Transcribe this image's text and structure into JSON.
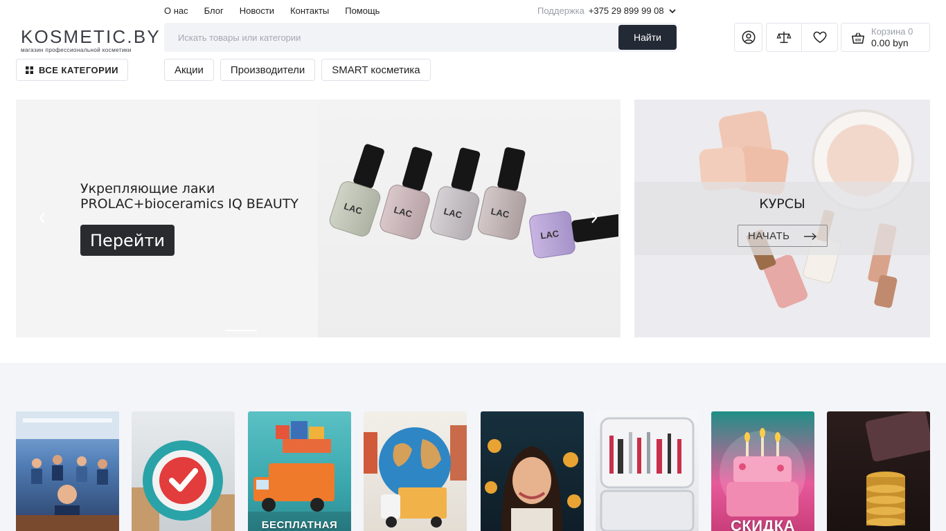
{
  "topnav": {
    "items": [
      "О нас",
      "Блог",
      "Новости",
      "Контакты",
      "Помощь"
    ]
  },
  "support": {
    "label": "Поддержка",
    "phone": "+375 29 899 99 08"
  },
  "logo": {
    "brand": "KOSMETIC.BY",
    "tagline": "магазин профессиональной косметики"
  },
  "search": {
    "placeholder": "Искать товары или категории",
    "button": "Найти"
  },
  "cart": {
    "label": "Корзина 0",
    "total": "0.00 byn"
  },
  "categories": {
    "all_label": "ВСЕ КАТЕГОРИИ",
    "pills": [
      "Акции",
      "Производители",
      "SMART косметика"
    ]
  },
  "main_banner": {
    "title_line1": "Укрепляющие лаки",
    "title_line2": "PROLAC+bioceramics IQ BEAUTY",
    "button": "Перейти",
    "bottle_label": "LAC"
  },
  "courses_banner": {
    "title": "КУРСЫ",
    "button": "НАЧАТЬ"
  },
  "promo_cards": {
    "card3_text": "БЕСПЛАТНАЯ",
    "card7_text": "СКИДКА"
  },
  "colors": {
    "accent_dark": "#242a35",
    "page_bg": "#ffffff",
    "section_bg": "#f4f5f9"
  }
}
